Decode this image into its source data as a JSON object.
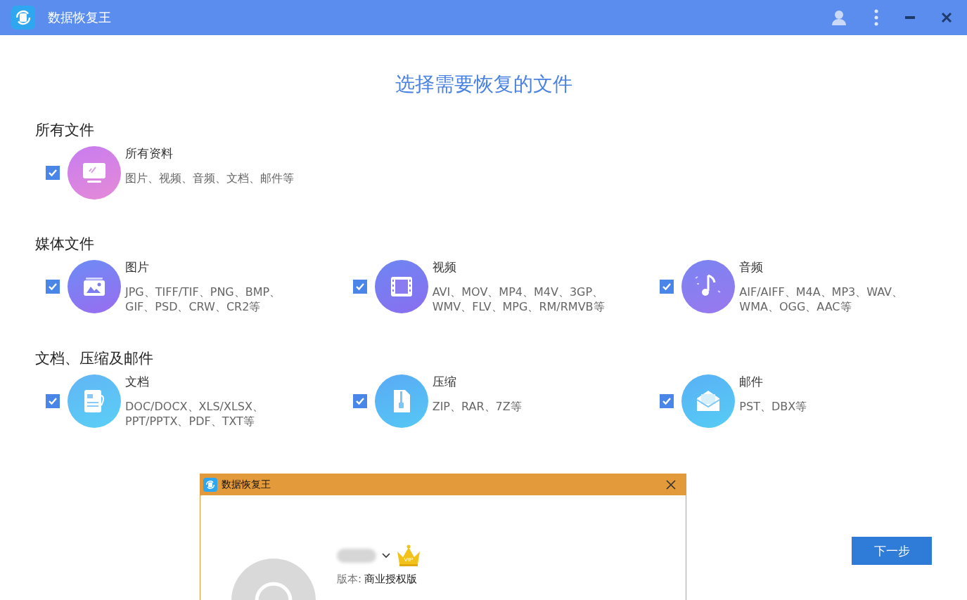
{
  "window": {
    "title": "数据恢复王"
  },
  "heading": "选择需要恢复的文件",
  "sections": [
    {
      "title": "所有文件",
      "items": [
        {
          "kind": "all",
          "name": "所有资料",
          "formats": "图片、视频、音频、文档、邮件等",
          "checked": true
        }
      ]
    },
    {
      "title": "媒体文件",
      "items": [
        {
          "kind": "image",
          "name": "图片",
          "formats": "JPG、TIFF/TIF、PNG、BMP、GIF、PSD、CRW、CR2等",
          "checked": true
        },
        {
          "kind": "video",
          "name": "视频",
          "formats": "AVI、MOV、MP4、M4V、3GP、WMV、FLV、MPG、RM/RMVB等",
          "checked": true
        },
        {
          "kind": "audio",
          "name": "音频",
          "formats": "AIF/AIFF、M4A、MP3、WAV、WMA、OGG、AAC等",
          "checked": true
        }
      ]
    },
    {
      "title": "文档、压缩及邮件",
      "items": [
        {
          "kind": "document",
          "name": "文档",
          "formats": "DOC/DOCX、XLS/XLSX、PPT/PPTX、PDF、TXT等",
          "checked": true
        },
        {
          "kind": "archive",
          "name": "压缩",
          "formats": "ZIP、RAR、7Z等",
          "checked": true
        },
        {
          "kind": "mail",
          "name": "邮件",
          "formats": "PST、DBX等",
          "checked": true
        }
      ]
    }
  ],
  "next_button": "下一步",
  "dialog": {
    "title": "数据恢复王",
    "vip_badge": "VIP",
    "version_label": "版本:",
    "version_value": "商业授权版"
  }
}
